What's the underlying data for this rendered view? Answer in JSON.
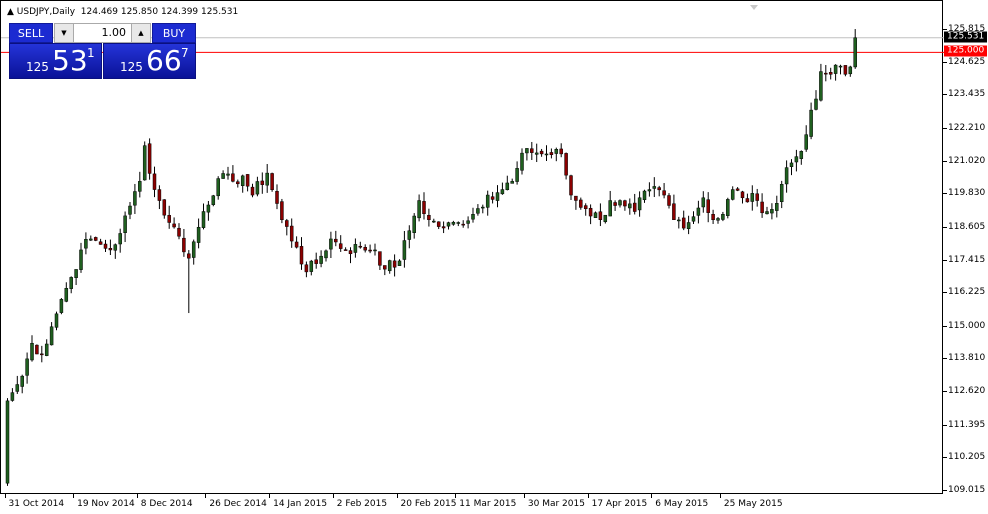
{
  "header": {
    "collapse_icon": "triangle-up-icon",
    "symbol": "USDJPY,Daily",
    "ohlc": "124.469 125.850 124.399 125.531"
  },
  "trade_panel": {
    "sell_label": "SELL",
    "buy_label": "BUY",
    "lot_value": "1.00",
    "sell_quote": {
      "prefix": "125",
      "big": "53",
      "sup": "1"
    },
    "buy_quote": {
      "prefix": "125",
      "big": "66",
      "sup": "7"
    }
  },
  "colors": {
    "bull": "#1f5f1f",
    "bear": "#8b0000",
    "level_line": "#ff0000",
    "bid_line": "#c0c0c0",
    "panel": "#1c2bd1"
  },
  "chart_data": {
    "type": "candlestick",
    "symbol": "USDJPY",
    "timeframe": "Daily",
    "y_ticks": [
      "125.815",
      "124.625",
      "123.435",
      "122.210",
      "121.020",
      "119.830",
      "118.605",
      "117.415",
      "116.225",
      "115.000",
      "113.810",
      "112.620",
      "111.395",
      "110.205",
      "109.015"
    ],
    "x_ticks": [
      "31 Oct 2014",
      "19 Nov 2014",
      "8 Dec 2014",
      "26 Dec 2014",
      "14 Jan 2015",
      "2 Feb 2015",
      "20 Feb 2015",
      "11 Mar 2015",
      "30 Mar 2015",
      "17 Apr 2015",
      "6 May 2015",
      "25 May 2015"
    ],
    "x_tick_bar_index": [
      5,
      19,
      32,
      46,
      59,
      72,
      85,
      97,
      111,
      124,
      137,
      151
    ],
    "ylim": [
      108.8,
      126.0
    ],
    "current_price": "125.531",
    "level_price": "125.000",
    "close_keypoints": [
      [
        0,
        112.3
      ],
      [
        1,
        112.6
      ],
      [
        3,
        113.2
      ],
      [
        5,
        114.4
      ],
      [
        7,
        114.0
      ],
      [
        9,
        115.0
      ],
      [
        11,
        116.0
      ],
      [
        13,
        116.8
      ],
      [
        15,
        117.8
      ],
      [
        17,
        118.2
      ],
      [
        19,
        118.0
      ],
      [
        21,
        117.8
      ],
      [
        23,
        118.4
      ],
      [
        25,
        119.4
      ],
      [
        27,
        120.3
      ],
      [
        28,
        121.6
      ],
      [
        30,
        120.0
      ],
      [
        33,
        118.8
      ],
      [
        35,
        118.3
      ],
      [
        37,
        117.5
      ],
      [
        40,
        119.2
      ],
      [
        43,
        120.4
      ],
      [
        46,
        120.3
      ],
      [
        48,
        120.5
      ],
      [
        50,
        119.8
      ],
      [
        53,
        120.6
      ],
      [
        56,
        118.9
      ],
      [
        59,
        117.9
      ],
      [
        61,
        117.0
      ],
      [
        63,
        117.3
      ],
      [
        66,
        118.2
      ],
      [
        69,
        117.8
      ],
      [
        72,
        117.9
      ],
      [
        75,
        117.8
      ],
      [
        77,
        117.1
      ],
      [
        80,
        117.4
      ],
      [
        82,
        118.5
      ],
      [
        84,
        119.6
      ],
      [
        86,
        118.9
      ],
      [
        89,
        118.6
      ],
      [
        92,
        118.8
      ],
      [
        95,
        119.1
      ],
      [
        98,
        119.8
      ],
      [
        101,
        120.0
      ],
      [
        103,
        120.3
      ],
      [
        106,
        121.5
      ],
      [
        109,
        121.3
      ],
      [
        113,
        121.3
      ],
      [
        115,
        119.8
      ],
      [
        118,
        119.3
      ],
      [
        121,
        118.9
      ],
      [
        123,
        119.6
      ],
      [
        126,
        119.4
      ],
      [
        128,
        119.2
      ],
      [
        131,
        120.0
      ],
      [
        134,
        119.8
      ],
      [
        136,
        118.9
      ],
      [
        139,
        118.8
      ],
      [
        142,
        119.7
      ],
      [
        144,
        118.9
      ],
      [
        146,
        119.1
      ],
      [
        148,
        120.0
      ],
      [
        150,
        119.7
      ],
      [
        153,
        119.6
      ],
      [
        155,
        119.2
      ],
      [
        157,
        119.5
      ],
      [
        159,
        120.8
      ],
      [
        161,
        121.2
      ],
      [
        163,
        122.0
      ],
      [
        165,
        123.3
      ],
      [
        166,
        124.3
      ],
      [
        168,
        124.2
      ],
      [
        170,
        124.5
      ],
      [
        171,
        124.2
      ],
      [
        172,
        124.47
      ],
      [
        173,
        125.531
      ]
    ],
    "last_bar": {
      "open": 124.469,
      "high": 125.85,
      "low": 124.399,
      "close": 125.531
    },
    "bar_count": 153
  }
}
